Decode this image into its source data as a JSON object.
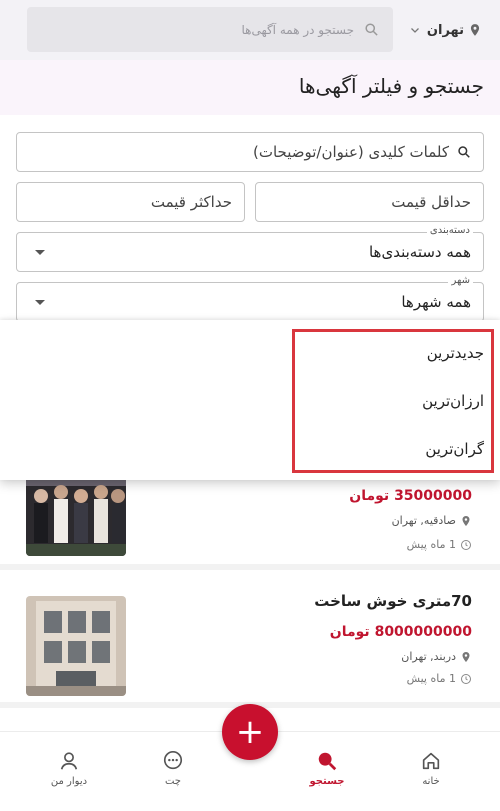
{
  "header": {
    "city": "تهران",
    "search_placeholder": "جستجو در همه آگهی‌ها"
  },
  "page_title": "جستجو و فیلتر آگهی‌ها",
  "filters": {
    "keywords_placeholder": "کلمات کلیدی (عنوان/توضیحات)",
    "min_price_placeholder": "حداقل قیمت",
    "max_price_placeholder": "حداکثر قیمت",
    "category_label": "دسته‌بندی",
    "category_value": "همه دسته‌بندی‌ها",
    "city_label": "شهر",
    "city_value": "همه شهرها"
  },
  "sort_menu": {
    "options": [
      "جدیدترین",
      "ارزان‌ترین",
      "گران‌ترین"
    ]
  },
  "listings": [
    {
      "title": "",
      "price": "35000000 تومان",
      "location": "صادقیه, تهران",
      "time": "1 ماه پیش"
    },
    {
      "title": "70متری خوش ساخت",
      "price": "8000000000 تومان",
      "location": "دربند, تهران",
      "time": "1 ماه پیش"
    }
  ],
  "bottom_nav": {
    "home": "خانه",
    "search": "جستجو",
    "chat": "چت",
    "me": "دیوار من",
    "add": "+"
  },
  "colors": {
    "accent": "#c0152f",
    "fab": "#c8102e",
    "highlight": "#d9363e"
  }
}
